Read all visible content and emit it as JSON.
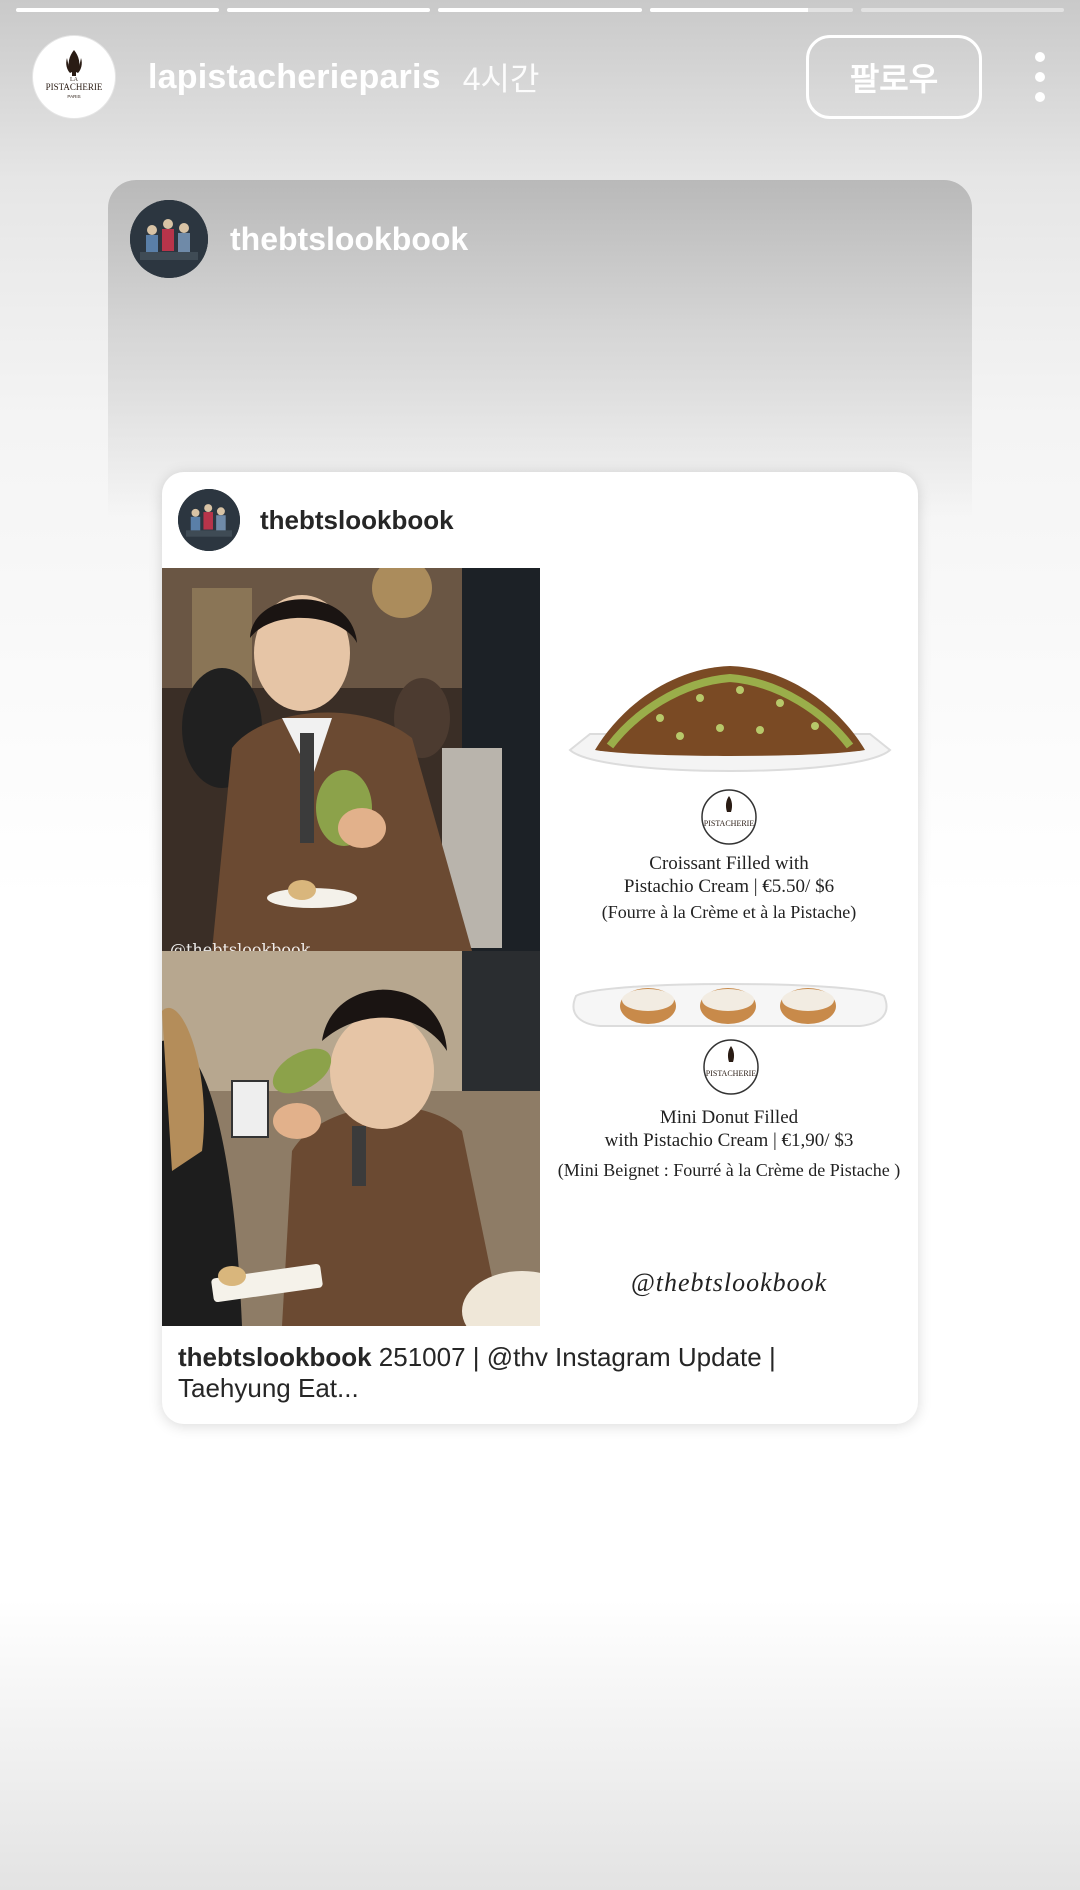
{
  "story": {
    "progress": [
      1.0,
      1.0,
      1.0,
      0.78,
      0.0
    ]
  },
  "header": {
    "username": "lapistacherieparis",
    "time": "4시간",
    "follow_label": "팔로우",
    "logo_text": "PISTACHERIE",
    "logo_top": "LA",
    "logo_bottom": "PARIS"
  },
  "shared": {
    "username": "thebtslookbook"
  },
  "post": {
    "username": "thebtslookbook",
    "watermark": "@thebtslookbook",
    "image_watermark": "@thebtslookbook",
    "menu": [
      {
        "title_line1": "Croissant Filled with",
        "title_line2": "Pistachio Cream | €5.50/ $6",
        "subtitle": "(Fourre à la Crème et à la Pistache)"
      },
      {
        "title_line1": "Mini Donut Filled",
        "title_line2": "with Pistachio Cream | €1,90/ $3",
        "subtitle": "(Mini Beignet : Fourré à la Crème de Pistache )"
      }
    ],
    "signature": "@thebtslookbook",
    "caption_user": "thebtslookbook",
    "caption_text": " 251007 | @thv Instagram Update | Taehyung Eat..."
  }
}
